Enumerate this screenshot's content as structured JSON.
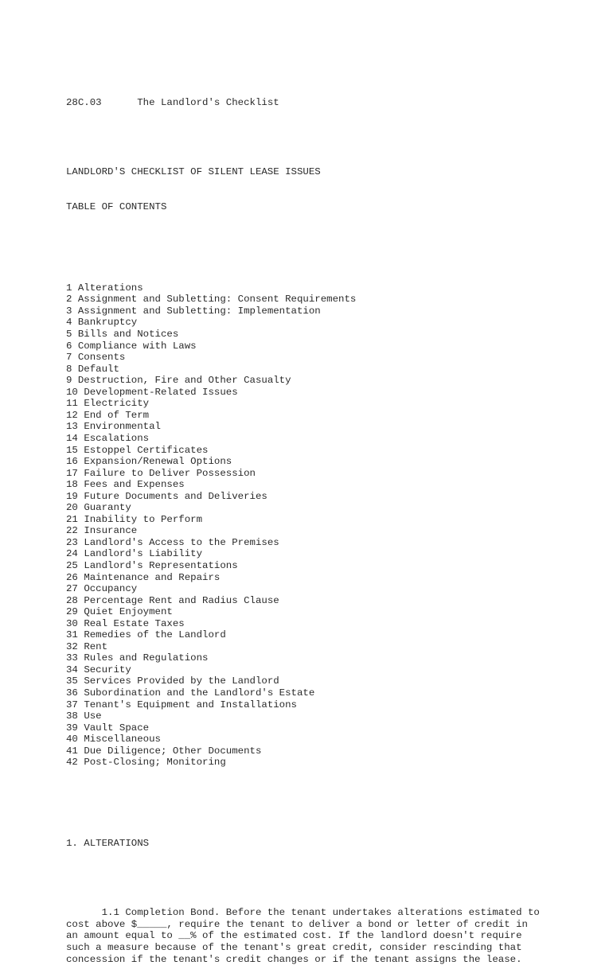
{
  "header": {
    "section_number": "28C.03",
    "section_title": "The Landlord's Checklist"
  },
  "document_title": "LANDLORD'S CHECKLIST OF SILENT LEASE ISSUES",
  "toc_heading": "TABLE OF CONTENTS",
  "toc": [
    {
      "num": "1",
      "label": "Alterations"
    },
    {
      "num": "2",
      "label": "Assignment and Subletting: Consent Requirements"
    },
    {
      "num": "3",
      "label": "Assignment and Subletting: Implementation"
    },
    {
      "num": "4",
      "label": "Bankruptcy"
    },
    {
      "num": "5",
      "label": "Bills and Notices"
    },
    {
      "num": "6",
      "label": "Compliance with Laws"
    },
    {
      "num": "7",
      "label": "Consents"
    },
    {
      "num": "8",
      "label": "Default"
    },
    {
      "num": "9",
      "label": "Destruction, Fire and Other Casualty"
    },
    {
      "num": "10",
      "label": "Development-Related Issues"
    },
    {
      "num": "11",
      "label": "Electricity"
    },
    {
      "num": "12",
      "label": "End of Term"
    },
    {
      "num": "13",
      "label": "Environmental"
    },
    {
      "num": "14",
      "label": "Escalations"
    },
    {
      "num": "15",
      "label": "Estoppel Certificates"
    },
    {
      "num": "16",
      "label": "Expansion/Renewal Options"
    },
    {
      "num": "17",
      "label": "Failure to Deliver Possession"
    },
    {
      "num": "18",
      "label": "Fees and Expenses"
    },
    {
      "num": "19",
      "label": "Future Documents and Deliveries"
    },
    {
      "num": "20",
      "label": "Guaranty"
    },
    {
      "num": "21",
      "label": "Inability to Perform"
    },
    {
      "num": "22",
      "label": "Insurance"
    },
    {
      "num": "23",
      "label": "Landlord's Access to the Premises"
    },
    {
      "num": "24",
      "label": "Landlord's Liability"
    },
    {
      "num": "25",
      "label": "Landlord's Representations"
    },
    {
      "num": "26",
      "label": "Maintenance and Repairs"
    },
    {
      "num": "27",
      "label": "Occupancy"
    },
    {
      "num": "28",
      "label": "Percentage Rent and Radius Clause"
    },
    {
      "num": "29",
      "label": "Quiet Enjoyment"
    },
    {
      "num": "30",
      "label": "Real Estate Taxes"
    },
    {
      "num": "31",
      "label": "Remedies of the Landlord"
    },
    {
      "num": "32",
      "label": "Rent"
    },
    {
      "num": "33",
      "label": "Rules and Regulations"
    },
    {
      "num": "34",
      "label": "Security"
    },
    {
      "num": "35",
      "label": "Services Provided by the Landlord"
    },
    {
      "num": "36",
      "label": "Subordination and the Landlord's Estate"
    },
    {
      "num": "37",
      "label": "Tenant's Equipment and Installations"
    },
    {
      "num": "38",
      "label": "Use"
    },
    {
      "num": "39",
      "label": "Vault Space"
    },
    {
      "num": "40",
      "label": "Miscellaneous"
    },
    {
      "num": "41",
      "label": "Due Diligence; Other Documents"
    },
    {
      "num": "42",
      "label": "Post-Closing; Monitoring"
    }
  ],
  "section_1": {
    "heading": "1. ALTERATIONS",
    "paragraph_lines": [
      "      1.1 Completion Bond. Before the tenant undertakes alterations estimated to",
      "cost above $_____, require the tenant to deliver a bond or letter of credit in",
      "an amount equal to __% of the estimated cost. If the landlord doesn't require",
      "such a measure because of the tenant's great credit, consider rescinding that",
      "concession if the tenant's credit changes or if the tenant assigns the lease."
    ]
  }
}
